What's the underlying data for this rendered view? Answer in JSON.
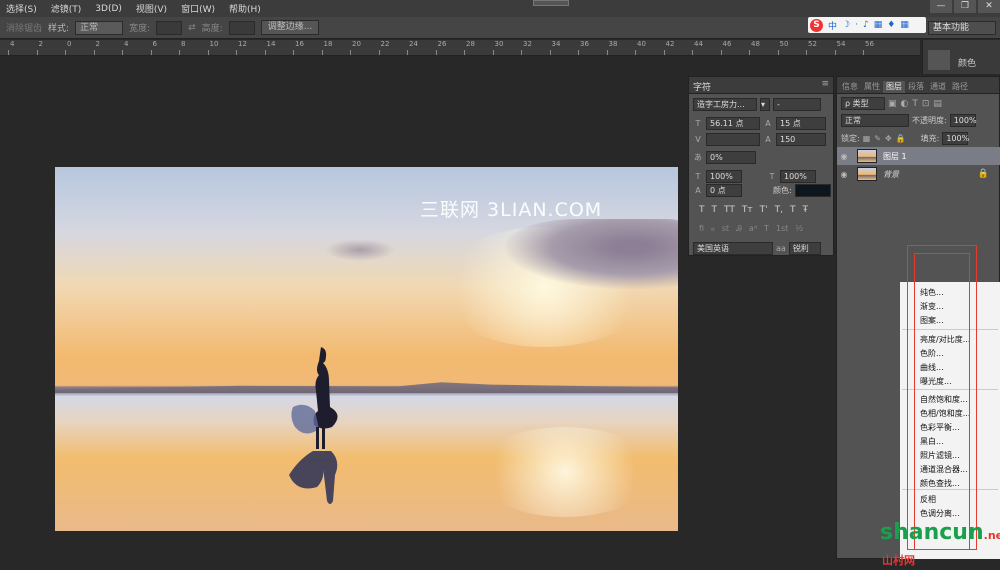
{
  "menu": [
    "选择(S)",
    "滤镜(T)",
    "3D(D)",
    "视图(V)",
    "窗口(W)",
    "帮助(H)"
  ],
  "window_controls": [
    "—",
    "❐",
    "✕"
  ],
  "options": {
    "feather": "消除锯齿",
    "style_label": "样式:",
    "style_value": "正常",
    "width_label": "宽度:",
    "height_label": "高度:",
    "refine_button": "调整边缘..."
  },
  "workspace": "基本功能",
  "ime": {
    "letter": "S",
    "glyphs": [
      "中",
      "☽",
      "·",
      "🎤",
      "▦",
      "👕",
      "▦"
    ]
  },
  "ruler": {
    "ticks": [
      "4",
      "2",
      "0",
      "2",
      "4",
      "6",
      "8",
      "10",
      "12",
      "14",
      "16",
      "18",
      "20",
      "22",
      "24",
      "26",
      "28",
      "30",
      "32",
      "34",
      "36",
      "38",
      "40",
      "42",
      "44",
      "46",
      "48",
      "50",
      "52",
      "54",
      "56"
    ]
  },
  "dock": {
    "color_label": "颜色"
  },
  "watermark": "三联网 3LIAN.COM",
  "character": {
    "tab": "字符",
    "font_family": "造字工房力...",
    "font_style": "-",
    "font_size": "56.11 点",
    "leading": "15 点",
    "kerning": "",
    "tracking": "150",
    "scale_pct": "0%",
    "vscale": "100%",
    "hscale": "100%",
    "baseline": "0 点",
    "color_label": "颜色:",
    "style_buttons": [
      "T",
      "T",
      "TT",
      "Tт",
      "T'",
      "T,",
      "T",
      "Ŧ"
    ],
    "ot_buttons": [
      "fi",
      "ℴ",
      "st",
      "Ꭿ",
      "aᵈ",
      "T",
      "1st",
      "½"
    ],
    "language": "美国英语",
    "aa_label": "aa",
    "aa_value": "锐利"
  },
  "layers": {
    "tabs": [
      "信息",
      "属性",
      "图层",
      "段落",
      "通道",
      "路径"
    ],
    "active_tab": "图层",
    "filter": "ρ 类型",
    "blend": "正常",
    "opacity_label": "不透明度:",
    "opacity": "100%",
    "lock_label": "锁定:",
    "fill_label": "填充:",
    "fill": "100%",
    "items": [
      {
        "name": "图层 1",
        "selected": true
      },
      {
        "name": "背景",
        "selected": false
      }
    ]
  },
  "adjust_menu": [
    "纯色...",
    "渐变...",
    "图案...",
    "亮度/对比度...",
    "色阶...",
    "曲线...",
    "曝光度...",
    "自然饱和度...",
    "色相/饱和度...",
    "色彩平衡...",
    "黑白...",
    "照片滤镜...",
    "通道混合器...",
    "颜色查找...",
    "反相",
    "色调分离..."
  ],
  "logo": {
    "text": "shancun",
    "suffix": ".net",
    "tag": "山村网"
  }
}
